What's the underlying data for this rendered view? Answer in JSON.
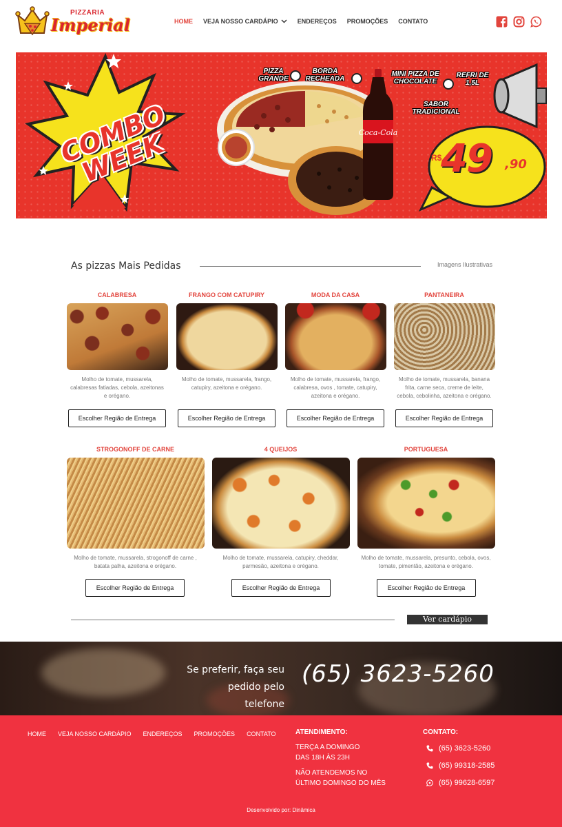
{
  "header": {
    "logo": {
      "top_text": "PIZZARIA",
      "brand": "Imperial"
    },
    "nav": [
      {
        "label": "HOME",
        "active": true
      },
      {
        "label": "VEJA NOSSO CARDÁPIO",
        "dropdown": true
      },
      {
        "label": "ENDEREÇOS"
      },
      {
        "label": "PROMOÇÕES"
      },
      {
        "label": "CONTATO"
      }
    ],
    "social_icons": [
      "facebook-icon",
      "instagram-icon",
      "whatsapp-icon"
    ]
  },
  "banner": {
    "headline": "COMBO WEEK",
    "items": [
      "PIZZA GRANDE",
      "BORDA RECHEADA",
      "MINI PIZZA DE CHOCOLATE",
      "REFRI DE 1,5L"
    ],
    "subtitle": "SABOR TRADICIONAL",
    "currency": "R$",
    "price": "49",
    "cents": ",90"
  },
  "section": {
    "title": "As pizzas Mais Pedidas",
    "note": "Imagens Ilustrativas"
  },
  "pizzas": [
    {
      "name": "CALABRESA",
      "desc": "Molho de tomate, mussarela, calabresas fatiadas, cebola, azeitonas e orégano.",
      "button": "Escolher Região de Entrega"
    },
    {
      "name": "FRANGO COM CATUPIRY",
      "desc": "Molho de tomate, mussarela, frango, catupiry, azeitona e orégano.",
      "button": "Escolher Região de Entrega"
    },
    {
      "name": "MODA DA CASA",
      "desc": "Molho de tomate, mussarela, frango, calabresa, ovos , tomate, catupiry, azeitona e orégano.",
      "button": "Escolher Região de Entrega"
    },
    {
      "name": "PANTANEIRA",
      "desc": "Molho de tomate, mussarela, banana frita, carne seca, creme de leite, cebola, cebolinha, azeitona e orégano.",
      "button": "Escolher Região de Entrega"
    },
    {
      "name": "STROGONOFF DE CARNE",
      "desc": "Molho de tomate, mussarela, strogonoff de carne , batata palha, azeitona e orégano.",
      "button": "Escolher Região de Entrega"
    },
    {
      "name": "4 QUEIJOS",
      "desc": "Molho de tomate, mussarela, catupiry, cheddar, parmesão, azeitona e orégano.",
      "button": "Escolher Região de Entrega"
    },
    {
      "name": "PORTUGUESA",
      "desc": "Molho de tomate, mussarela, presunto, cebola, ovos, tomate, pimentão, azeitona e orégano.",
      "button": "Escolher Região de Entrega"
    }
  ],
  "full_menu_link": "Ver cardápio completo",
  "phone_strip": {
    "text_line1": "Se preferir, faça seu",
    "text_line2": "pedido pelo telefone",
    "phone": "(65) 3623-5260"
  },
  "footer": {
    "nav": [
      "HOME",
      "VEJA NOSSO CARDÁPIO",
      "ENDEREÇOS",
      "PROMOÇÕES",
      "CONTATO"
    ],
    "attendance_title": "ATENDIMENTO:",
    "attendance_lines": [
      "TERÇA A DOMINGO",
      "DAS 18H ÀS 23H",
      "NÃO ATENDEMOS NO",
      "ÚLTIMO DOMINGO DO MÊS"
    ],
    "contact_title": "CONTATO:",
    "contacts": [
      {
        "icon": "phone-icon",
        "number": "(65) 3623-5260"
      },
      {
        "icon": "phone-icon",
        "number": "(65) 99318-2585"
      },
      {
        "icon": "whatsapp-icon",
        "number": "(65) 99628-6597"
      }
    ],
    "credit": "Desenvolvido por: Dinâmica"
  }
}
